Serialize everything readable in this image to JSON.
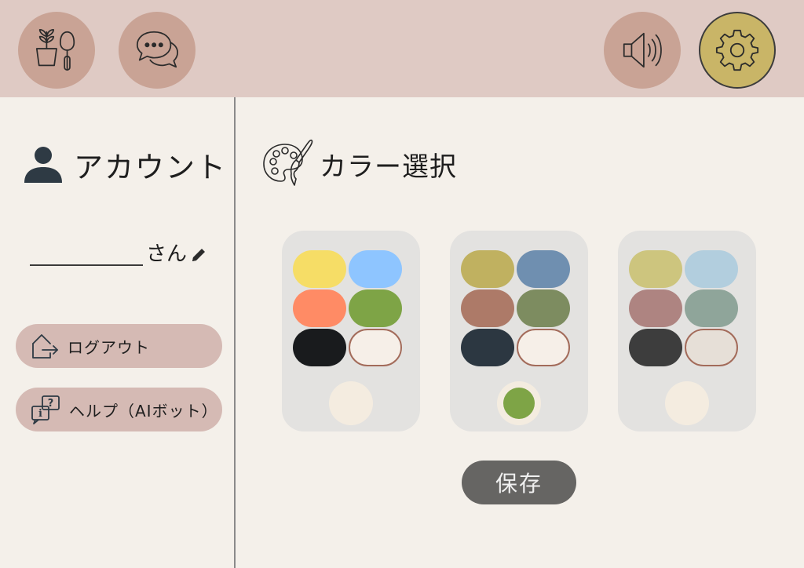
{
  "header": {
    "icons": [
      "gardening-icon",
      "chat-icon",
      "speaker-icon",
      "gear-icon"
    ],
    "colors": {
      "bar": "#dfcac4",
      "button": "#c9a395",
      "active_button": "#c9b567"
    }
  },
  "sidebar": {
    "account_title": "アカウント",
    "name_suffix": "さん",
    "logout_label": "ログアウト",
    "help_label": "ヘルプ（AIボット）"
  },
  "main": {
    "title": "カラー選択",
    "themes": [
      {
        "swatches": [
          "#f6dd66",
          "#8ec5ff",
          "#ff8b65",
          "#7ea446",
          "#191b1d",
          "#f6efe8"
        ],
        "selected": false
      },
      {
        "swatches": [
          "#c0b160",
          "#6f8fb0",
          "#ad7a68",
          "#7d8c60",
          "#2c3741",
          "#f6efe8"
        ],
        "selected": true
      },
      {
        "swatches": [
          "#cdc57e",
          "#b2cede",
          "#ae8481",
          "#8fa59a",
          "#3d3d3d",
          "#e6dfd7"
        ],
        "selected": false
      }
    ],
    "selected_dot_color": "#7ea446",
    "save_label": "保存"
  }
}
